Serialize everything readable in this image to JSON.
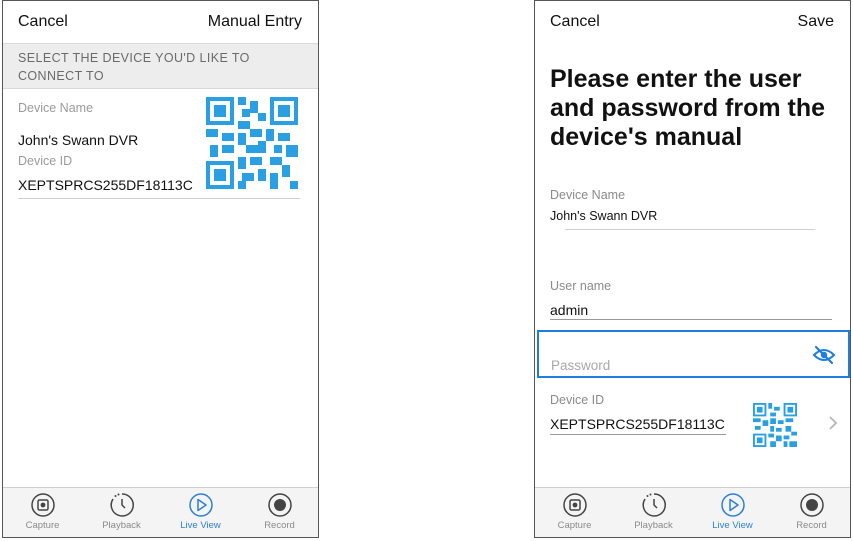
{
  "screen1": {
    "cancel": "Cancel",
    "manual_entry": "Manual Entry",
    "section_header": "SELECT THE DEVICE YOU'D LIKE TO CONNECT TO",
    "device_name_label": "Device Name",
    "device_name": "John's Swann DVR",
    "device_id_label": "Device ID",
    "device_id": "XEPTSPRCS255DF18113C"
  },
  "screen2": {
    "cancel": "Cancel",
    "save": "Save",
    "title": "Please enter the user and password from the device's manual",
    "device_name_label": "Device Name",
    "device_name": "John's Swann DVR",
    "username_label": "User name",
    "username": "admin",
    "password_placeholder": "Password",
    "device_id_label": "Device ID",
    "device_id": "XEPTSPRCS255DF18113C"
  },
  "tabs": [
    {
      "label": "Capture",
      "icon": "capture-icon",
      "active": false
    },
    {
      "label": "Playback",
      "icon": "playback-icon",
      "active": false
    },
    {
      "label": "Live View",
      "icon": "live-view-icon",
      "active": true
    },
    {
      "label": "Record",
      "icon": "record-icon",
      "active": false
    }
  ],
  "colors": {
    "accent": "#2d7fd8",
    "qr": "#2aa0e3",
    "focus_border": "#1f7de0"
  }
}
